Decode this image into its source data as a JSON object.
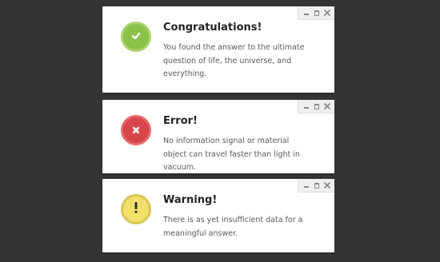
{
  "dialogs": [
    {
      "kind": "success",
      "title": "Congratulations!",
      "message": "You found the answer to the ultimate question of life, the universe, and everything.",
      "icon": "checkmark-icon",
      "color": "#8dc14a"
    },
    {
      "kind": "error",
      "title": "Error!",
      "message": "No information signal or material object can travel faster than light in vacuum.",
      "icon": "x-icon",
      "color": "#d9454b"
    },
    {
      "kind": "warning",
      "title": "Warning!",
      "message": "There is as yet insufficient data for a meaningful answer.",
      "icon": "exclamation-icon",
      "color": "#f2e06a"
    }
  ],
  "window_controls": [
    "minimize-icon",
    "maximize-icon",
    "close-icon"
  ],
  "background": "#353336"
}
